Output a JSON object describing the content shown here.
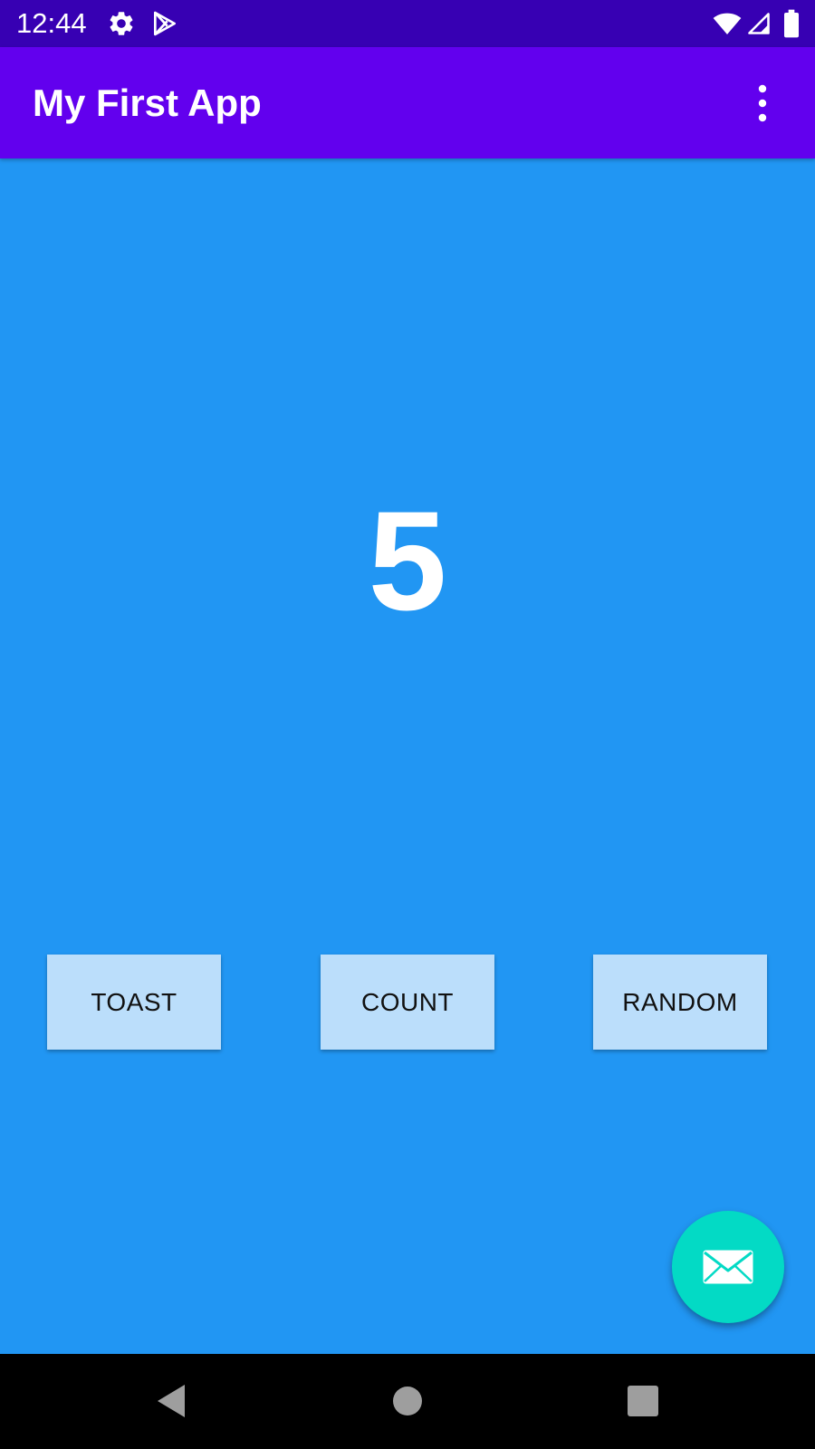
{
  "status_bar": {
    "time": "12:44",
    "icons": [
      "gear-icon",
      "play-store-icon",
      "wifi-icon",
      "cellular-signal-icon",
      "battery-icon"
    ]
  },
  "app_bar": {
    "title": "My First App",
    "menu_icon": "more-vert-icon"
  },
  "main": {
    "count_value": "5",
    "buttons": {
      "toast_label": "TOAST",
      "count_label": "COUNT",
      "random_label": "RANDOM"
    },
    "fab_icon": "email-icon"
  },
  "navigation": {
    "icons": [
      "back-icon",
      "home-icon",
      "recents-icon"
    ]
  },
  "colors": {
    "status_bar": "#3700B3",
    "app_bar": "#6200EE",
    "background": "#2196F3",
    "button": "#BBDEFB",
    "fab": "#03DAC5",
    "nav_bar": "#000000"
  }
}
